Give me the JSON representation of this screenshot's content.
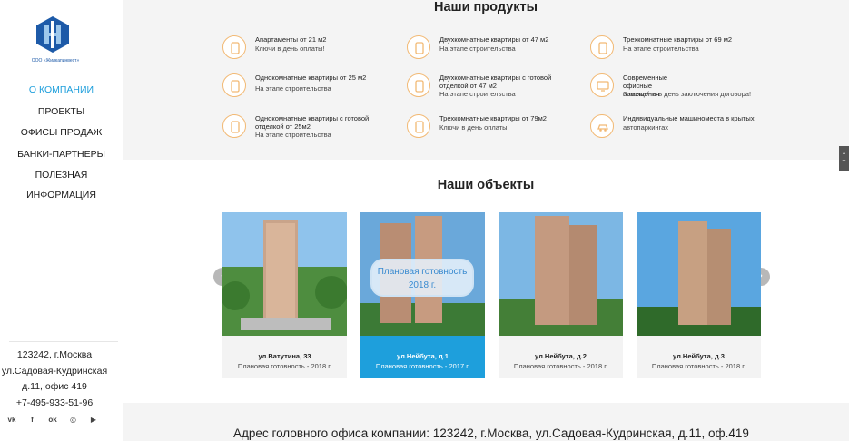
{
  "sidebar": {
    "logo_text": "ООО «Жилкапинвест»",
    "nav": [
      {
        "label": "О КОМПАНИИ",
        "active": true
      },
      {
        "label": "ПРОЕКТЫ",
        "active": false
      },
      {
        "label": "ОФИСЫ ПРОДАЖ",
        "active": false
      },
      {
        "label": "БАНКИ-ПАРТНЕРЫ",
        "active": false
      },
      {
        "label": "ПОЛЕЗНАЯ ИНФОРМАЦИЯ",
        "active": false
      }
    ],
    "contacts": {
      "line1": "123242, г.Москва",
      "line2": "ул.Садовая-Кудринская",
      "line3": "д.11, офис 419",
      "phone": "+7-495-933-51-96"
    },
    "socials": [
      {
        "name": "vk-icon",
        "glyph": "vk"
      },
      {
        "name": "facebook-icon",
        "glyph": "f"
      },
      {
        "name": "odnoklassniki-icon",
        "glyph": "ok"
      },
      {
        "name": "instagram-icon",
        "glyph": "◎"
      },
      {
        "name": "youtube-icon",
        "glyph": "▶"
      }
    ]
  },
  "products": {
    "title": "Наши продукты",
    "items": [
      {
        "title": "Апартаменты от 21 м2",
        "subtitle": "Ключи в день оплаты!",
        "icon": "phone-icon"
      },
      {
        "title": "Двухкомнатные квартиры от 47 м2",
        "subtitle": "На этапе строительства",
        "icon": "phone-icon"
      },
      {
        "title": "Трехкомнатные квартиры от 69 м2",
        "subtitle": "На этапе строительства",
        "icon": "phone-icon"
      },
      {
        "title": "Однокомнатные квартиры от 25 м2",
        "subtitle": "На этапе строительства",
        "icon": "phone-icon"
      },
      {
        "title": "Двухкомнатные квартиры с готовой отделкой от 47 м2",
        "subtitle": "На этапе строительства",
        "icon": "phone-icon"
      },
      {
        "title": "Современные офисные помещения",
        "subtitle": "Заезжайте в день заключения договора!",
        "icon": "monitor-icon"
      },
      {
        "title": "Однокомнатные квартиры с готовой отделкой от 25м2",
        "subtitle": "На этапе строительства",
        "icon": "phone-icon"
      },
      {
        "title": "Трехкомнатные квартиры от 79м2",
        "subtitle": "Ключи в день оплаты!",
        "icon": "phone-icon"
      },
      {
        "title": "Индивидуальные машиноместа в крытых",
        "subtitle": "автопаркингах",
        "icon": "car-icon"
      }
    ]
  },
  "objects": {
    "title": "Наши объекты",
    "cards": [
      {
        "name": "ул.Ватутина, 33",
        "subtitle": "Плановая готовность - 2018 г."
      },
      {
        "name": "ул.Нейбута, д.1",
        "subtitle": "Плановая готовность - 2017 г.",
        "bubble_line1": "Плановая готовность",
        "bubble_line2": "2018 г."
      },
      {
        "name": "ул.Нейбута, д.2",
        "subtitle": "Плановая готовность - 2018 г."
      },
      {
        "name": "ул.Нейбута, д.3",
        "subtitle": "Плановая готовность - 2018 г."
      }
    ],
    "prev_glyph": "‹",
    "next_glyph": "›"
  },
  "footer": {
    "address": "Адрес головного офиса компании: 123242, г.Москва, ул.Садовая-Кудринская, д.11, оф.419"
  },
  "totop": {
    "glyph": "^",
    "label": "Т"
  },
  "colors": {
    "accent": "#1e9fdc",
    "icon_ring": "#f2b974",
    "logo": "#1d5aa8"
  }
}
